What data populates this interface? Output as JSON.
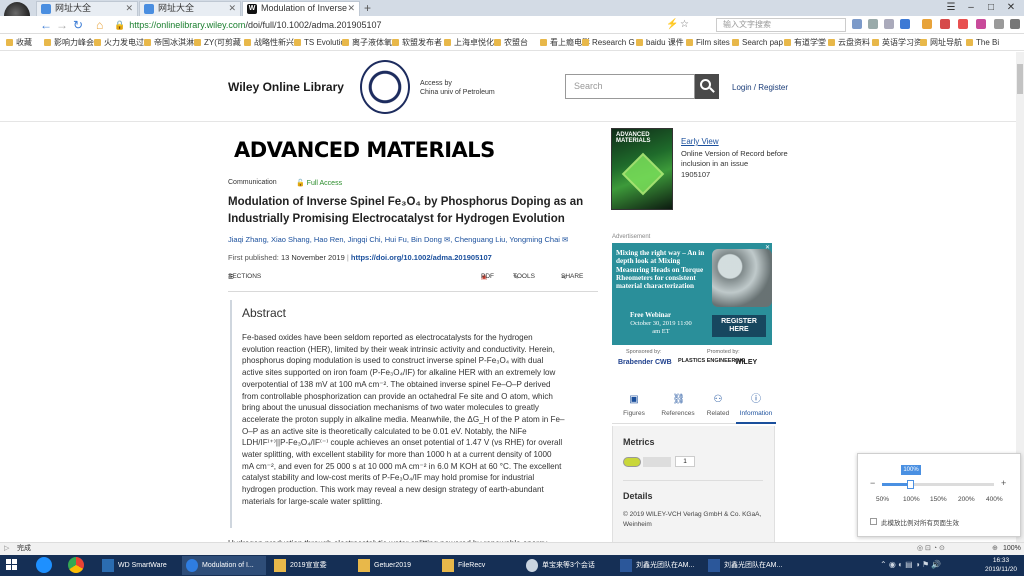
{
  "browser": {
    "tabs": [
      {
        "title": "网址大全"
      },
      {
        "title": "网址大全"
      },
      {
        "title": "Modulation of Inverse"
      }
    ],
    "url_host": "https://onlinelibrary.wiley.com",
    "url_path": "/doi/full/10.1002/adma.201905107",
    "search_placeholder": "输入文字搜索",
    "bookmarks": [
      "收藏",
      "影响力峰会",
      "火力发电过",
      "帝国冰淇淋",
      "ZY(可剪藏",
      "战略性新兴",
      "TS Evolution",
      "离子液体氧",
      "软盟发布者",
      "上海卓悦化",
      "农盟台",
      "看上瘾电影",
      "Research G",
      "baidu 课件",
      "Film sites",
      "Search pap",
      "有道学堂",
      "云盘资料",
      "英语学习资",
      "网址导航",
      "The Bi"
    ]
  },
  "header": {
    "site_name": "Wiley Online Library",
    "access_line1": "Access by",
    "access_line2": "China univ of Petroleum",
    "search_placeholder": "Search",
    "login": "Login / Register"
  },
  "article": {
    "journal": "ADVANCED MATERIALS",
    "type": "Communication",
    "access": "Full Access",
    "title": "Modulation of Inverse Spinel Fe₃O₄ by Phosphorus Doping as an Industrially Promising Electrocatalyst for Hydrogen Evolution",
    "authors": "Jiaqi Zhang,  Xiao Shang,  Hao Ren,  Jingqi Chi,  Hui Fu,  Bin Dong ✉,  Chenguang Liu,  Yongming Chai ✉",
    "published_label": "First published:",
    "published_date": "13 November 2019",
    "doi": "https://doi.org/10.1002/adma.201905107",
    "tools": {
      "sections": "SECTIONS",
      "pdf": "PDF",
      "tools": "TOOLS",
      "share": "SHARE"
    },
    "abstract_heading": "Abstract",
    "abstract_lines": [
      "Fe-based oxides have been seldom reported as electrocatalysts for the hydrogen",
      "evolution reaction (HER), limited by their weak intrinsic activity and conductivity. Herein,",
      "phosphorus doping modulation is used to construct inverse spinel P-Fe₃O₄ with dual",
      "active sites supported on iron foam (P-Fe₃O₄/IF) for alkaline HER with an extremely low",
      "overpotential of 138 mV at 100 mA cm⁻². The obtained inverse spinel Fe–O–P derived",
      "from controllable phosphorization can provide an octahedral Fe site and O atom, which",
      "bring about the unusual dissociation mechanisms of two water molecules to greatly",
      "accelerate the proton supply in alkaline media. Meanwhile, the ΔG_H of the P atom in Fe–",
      "O–P as an active site is theoretically calculated to be 0.01 eV. Notably, the NiFe",
      "LDH/IF⁽⁺⁾||P-Fe₃O₄/IF⁽⁻⁾ couple achieves an onset potential of 1.47 V (vs RHE) for overall",
      "water splitting, with excellent stability for more than 1000 h at a current density of 1000",
      "mA cm⁻², and even for 25 000 s at 10 000 mA cm⁻² in 6.0 M KOH at 60 °C. The excellent",
      "catalyst stability and low-cost merits of P-Fe₃O₄/IF may hold promise for industrial",
      "hydrogen production. This work may reveal a new design strategy of earth-abundant",
      "materials for large-scale water splitting."
    ],
    "below_text": "Hydrogen production through electrocatalytic water splitting powered by renewable energy"
  },
  "sidebar": {
    "cover_title": "ADVANCED MATERIALS",
    "early_view": "Early View",
    "early_desc": "Online Version of Record before inclusion in an issue",
    "article_number": "1905107",
    "ad_label": "Advertisement",
    "ad_text": "Mixing the right way – An in depth look at Mixing Measuring Heads on Torque Rheometers for consistent material characterization",
    "ad_webinar": "Free Webinar",
    "ad_date": "October 30, 2019 11:00 am ET",
    "ad_button": "REGISTER HERE",
    "sponsored_by": "Sponsored by:",
    "promoted_by": "Promoted by:",
    "sponsor1": "Brabender CWB",
    "sponsor2": "PLASTICS ENGINEERING",
    "sponsor3": "WILEY",
    "tabs": [
      "Figures",
      "References",
      "Related",
      "Information"
    ],
    "metrics_heading": "Metrics",
    "metrics_count": "1",
    "details_heading": "Details",
    "details_text": "© 2019 WILEY-VCH Verlag GmbH & Co. KGaA, Weinheim"
  },
  "zoom_popup": {
    "current": "100%",
    "levels": [
      "50%",
      "100%",
      "150%",
      "200%",
      "400%"
    ],
    "checkbox_label": "此模放比例对所有页面生效"
  },
  "statusbar": {
    "status": "完成",
    "zoom": "100%"
  },
  "taskbar": {
    "items": [
      "WD SmartWare",
      "Modulation of I...",
      "2019宣宣委",
      "Getuer2019",
      "FileRecv",
      "单宝来等3个会话",
      "刘鑫光团队在AM...",
      "刘鑫光团队在AM..."
    ],
    "time": "16:33",
    "date": "2019/11/20"
  },
  "colors": {
    "link": "#1a4f9c",
    "taskbar": "#152f55",
    "accent": "#4a90e2",
    "ad": "#2a8f9a"
  }
}
